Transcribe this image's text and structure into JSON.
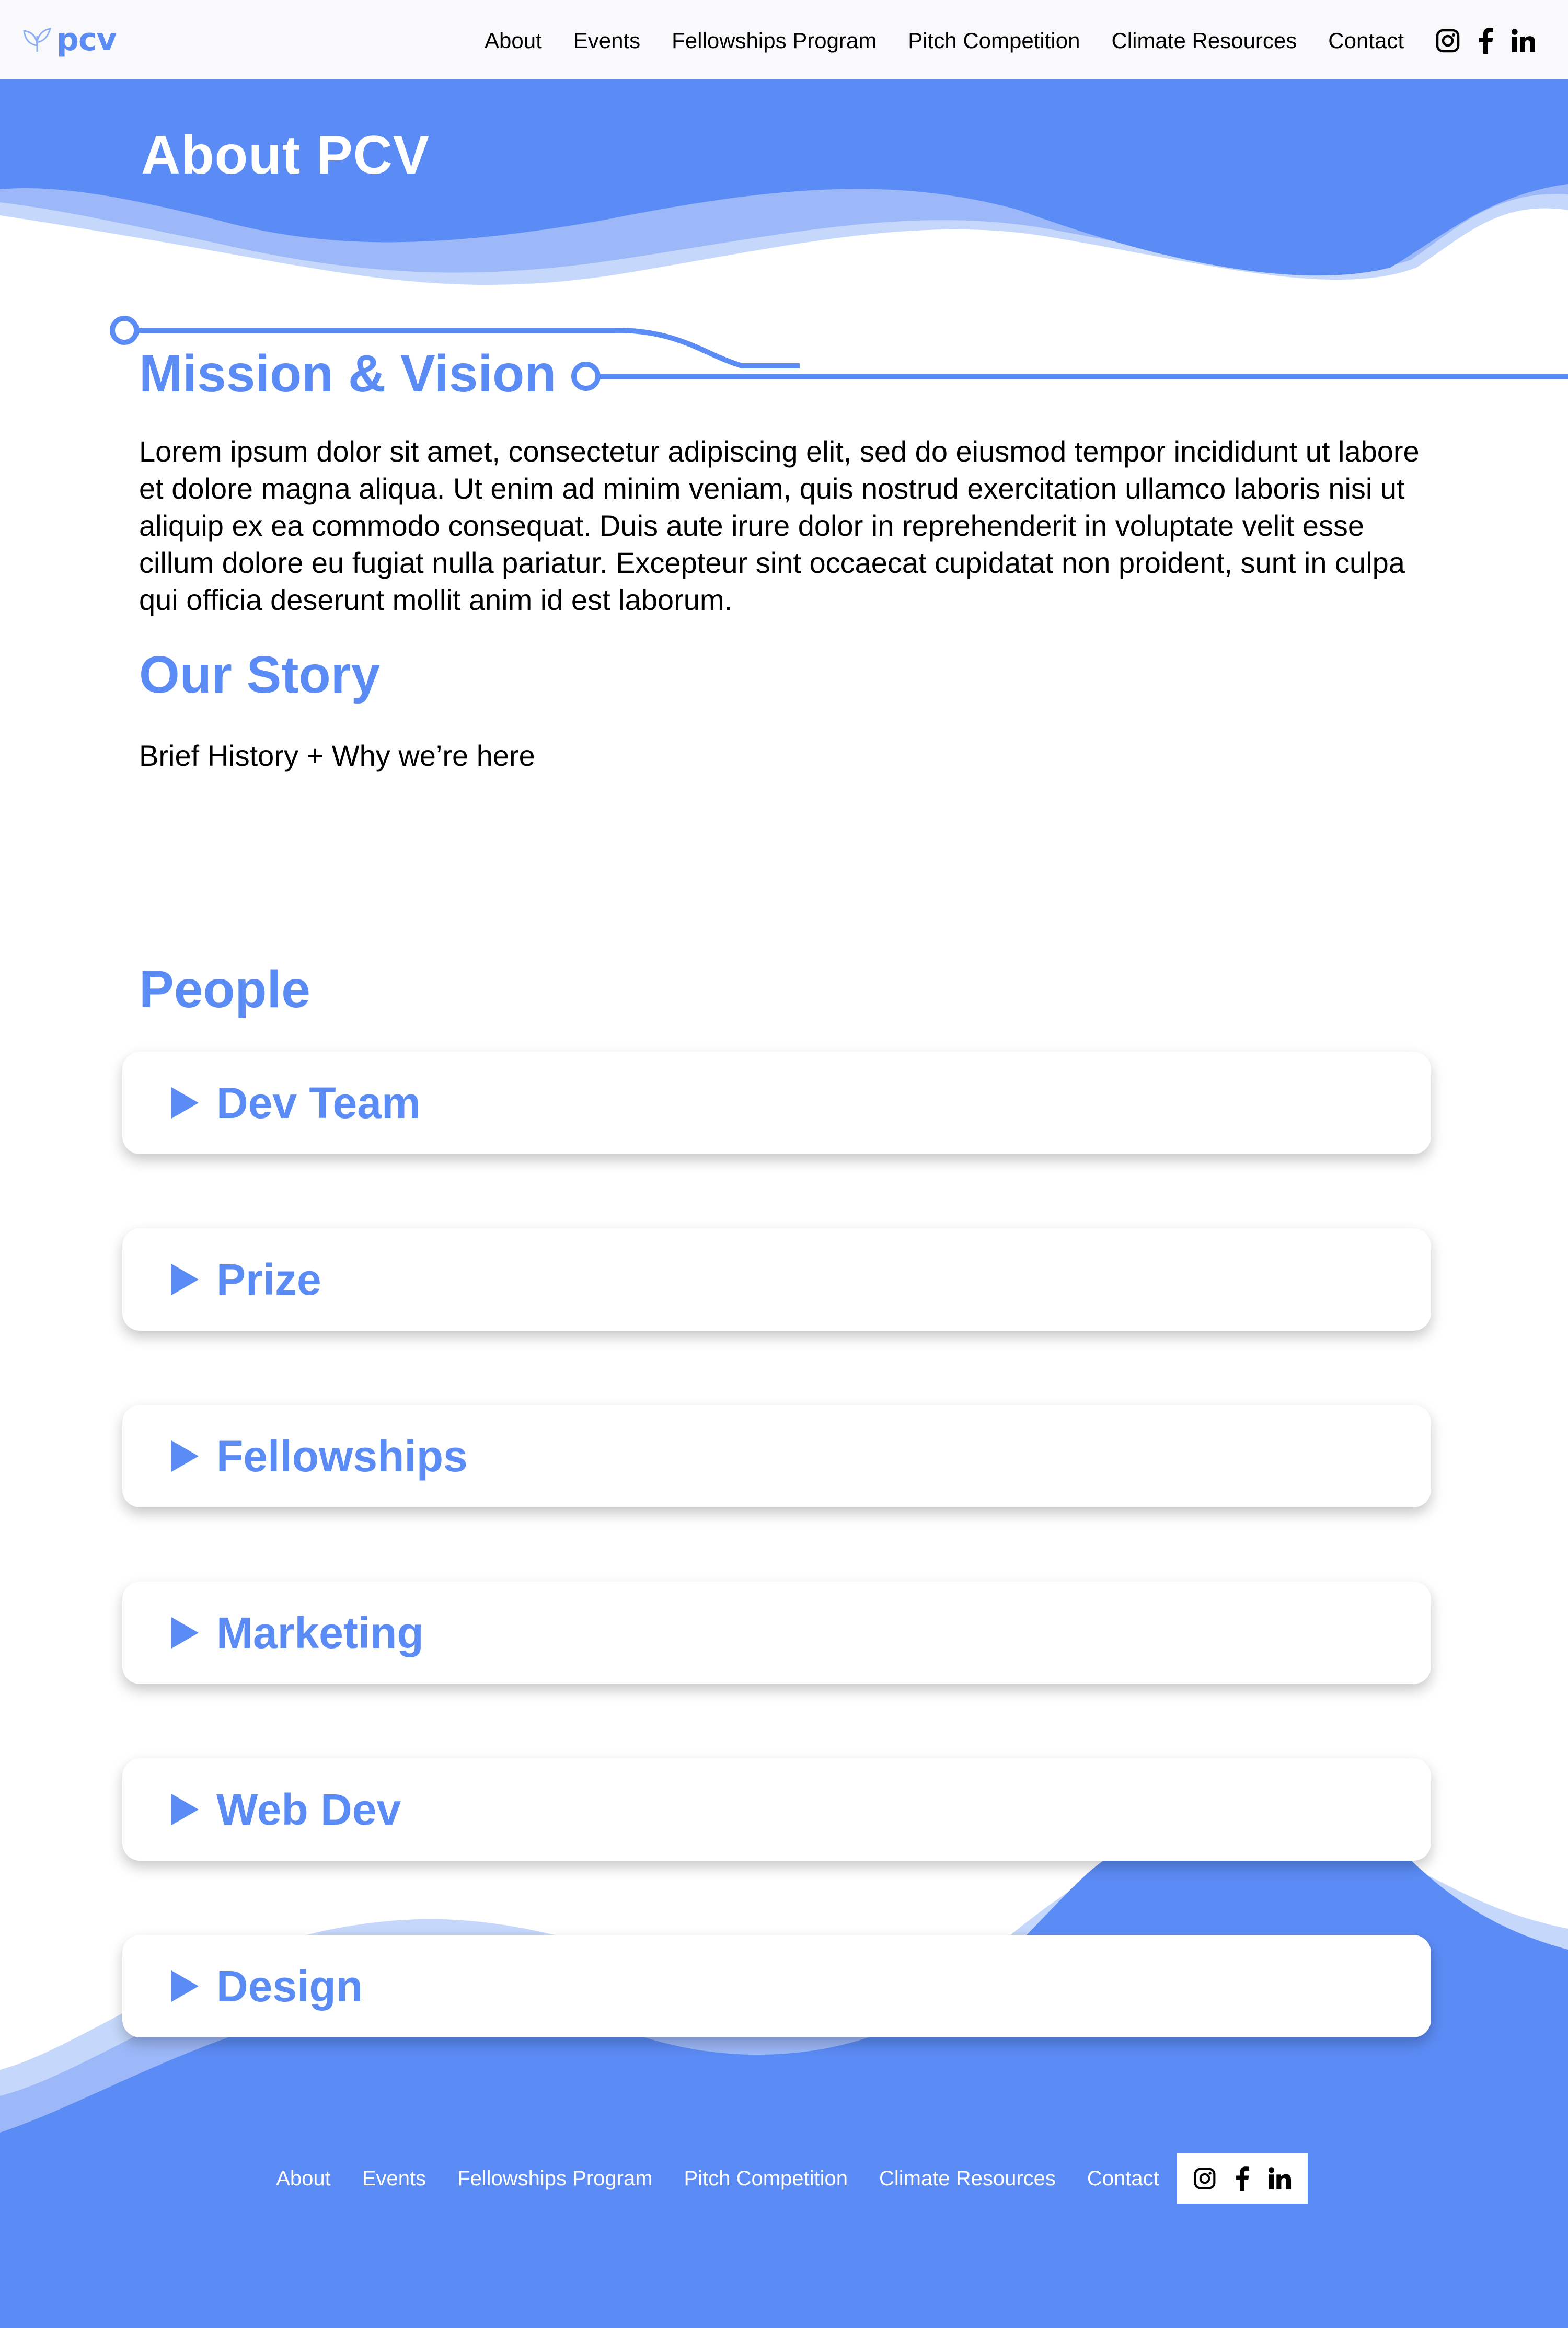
{
  "brand": {
    "logo_text": "pcv",
    "logo_icon": "leaf-icon",
    "accent_color": "#5b8bf5"
  },
  "nav": {
    "links": [
      "About",
      "Events",
      "Fellowships Program",
      "Pitch Competition",
      "Climate Resources",
      "Contact"
    ],
    "social_icons": [
      "instagram-icon",
      "facebook-icon",
      "linkedin-icon"
    ]
  },
  "hero": {
    "title": "About PCV"
  },
  "mission": {
    "title": "Mission & Vision",
    "body": "Lorem ipsum dolor sit amet, consectetur adipiscing elit, sed do eiusmod tempor incididunt ut labore et dolore magna aliqua. Ut enim ad minim veniam, quis nostrud exercitation ullamco laboris nisi ut aliquip ex ea commodo consequat. Duis aute irure dolor in reprehenderit in voluptate velit esse cillum dolore eu fugiat nulla pariatur. Excepteur sint occaecat cupidatat non proident, sunt in culpa qui officia deserunt mollit anim id est laborum."
  },
  "story": {
    "title": "Our Story",
    "body": "Brief History + Why we’re here"
  },
  "people": {
    "title": "People",
    "groups": [
      "Dev Team",
      "Prize",
      "Fellowships",
      "Marketing",
      "Web Dev",
      "Design"
    ]
  },
  "footer": {
    "links": [
      "About",
      "Events",
      "Fellowships Program",
      "Pitch Competition",
      "Climate Resources",
      "Contact"
    ],
    "social_icons": [
      "instagram-icon",
      "facebook-icon",
      "linkedin-icon"
    ]
  }
}
